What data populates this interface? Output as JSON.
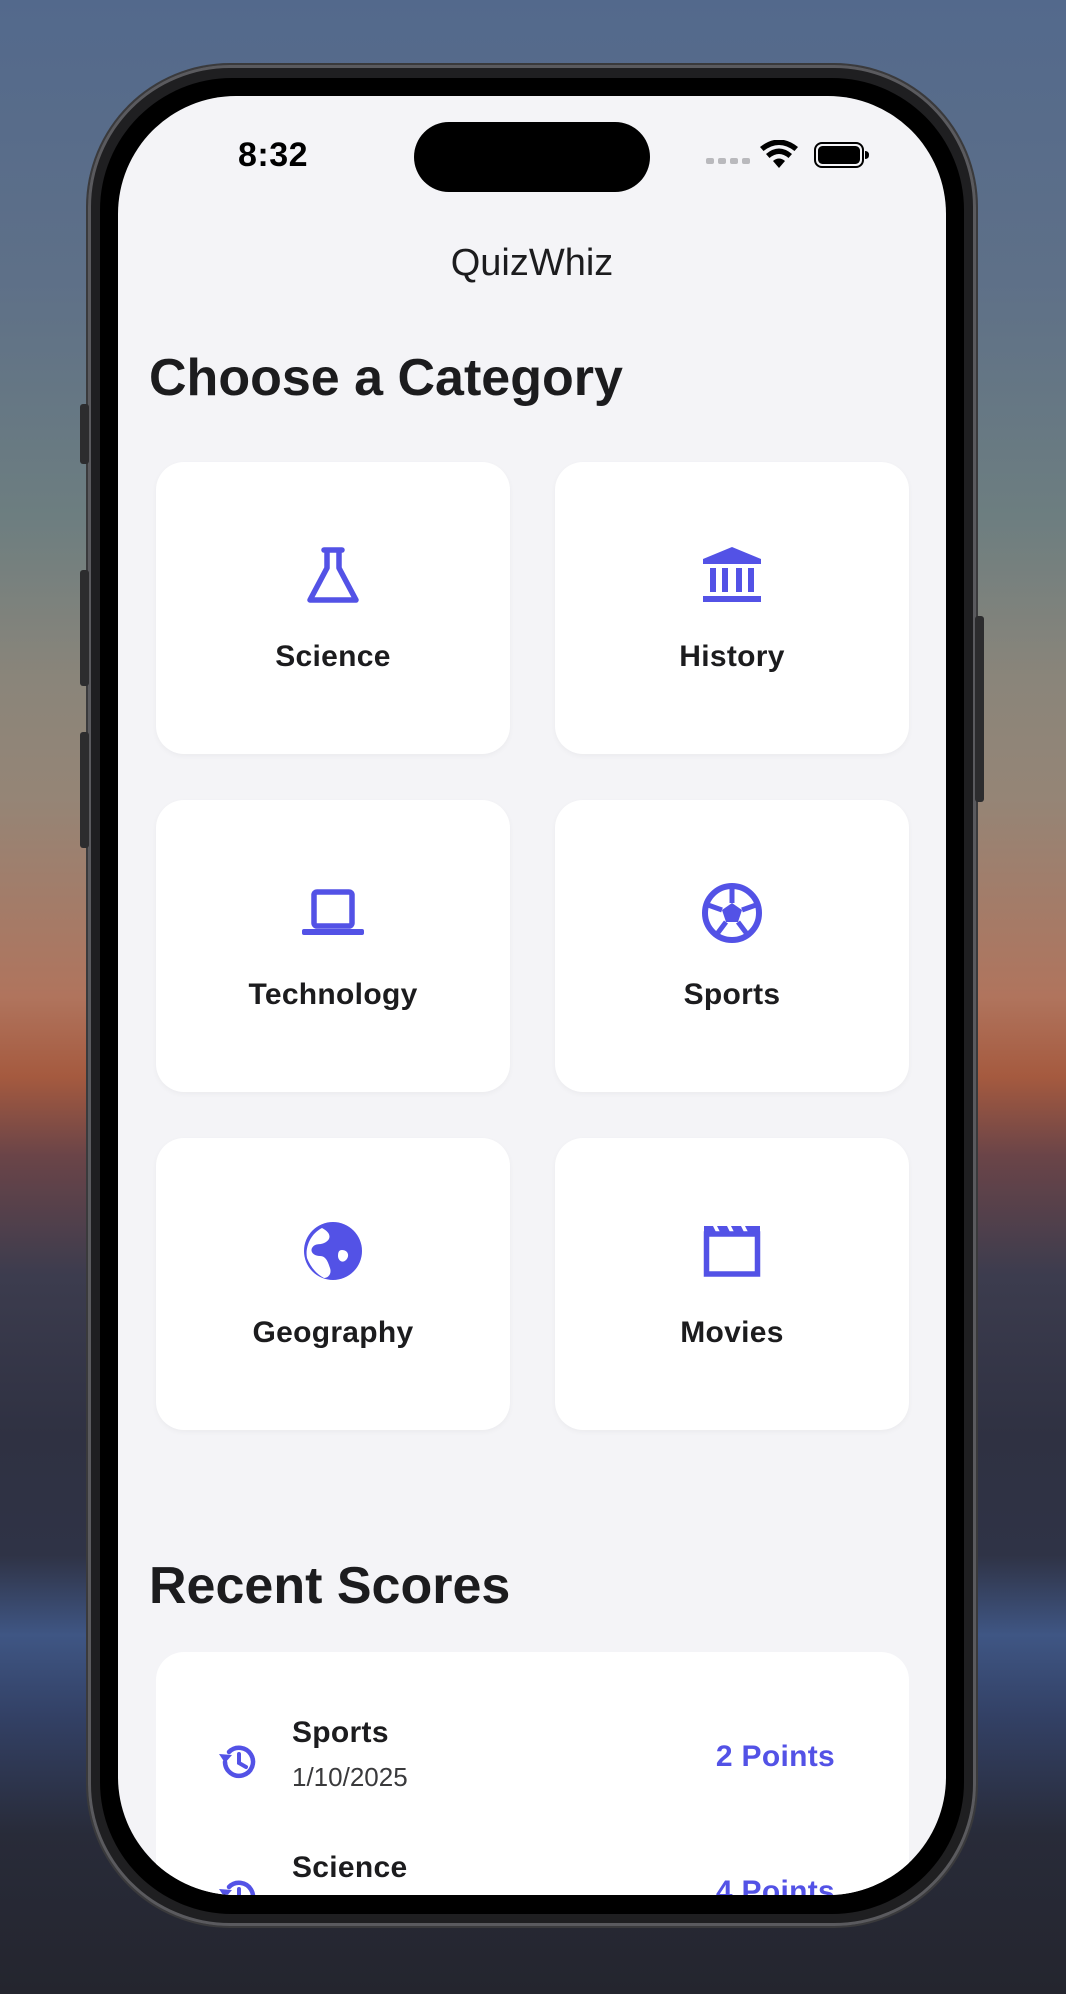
{
  "status_bar": {
    "time": "8:32"
  },
  "app": {
    "title": "QuizWhiz",
    "accent_color": "#5352e6"
  },
  "categories_section": {
    "title": "Choose a Category",
    "items": [
      {
        "label": "Science",
        "icon": "flask-icon"
      },
      {
        "label": "History",
        "icon": "bank-icon"
      },
      {
        "label": "Technology",
        "icon": "laptop-icon"
      },
      {
        "label": "Sports",
        "icon": "soccer-ball-icon"
      },
      {
        "label": "Geography",
        "icon": "globe-icon"
      },
      {
        "label": "Movies",
        "icon": "clapperboard-icon"
      }
    ]
  },
  "recent_scores": {
    "title": "Recent Scores",
    "items": [
      {
        "category": "Sports",
        "date": "1/10/2025",
        "points": "2 Points",
        "icon": "history-icon"
      },
      {
        "category": "Science",
        "date": "",
        "points": "4 Points",
        "icon": "history-icon"
      }
    ]
  }
}
